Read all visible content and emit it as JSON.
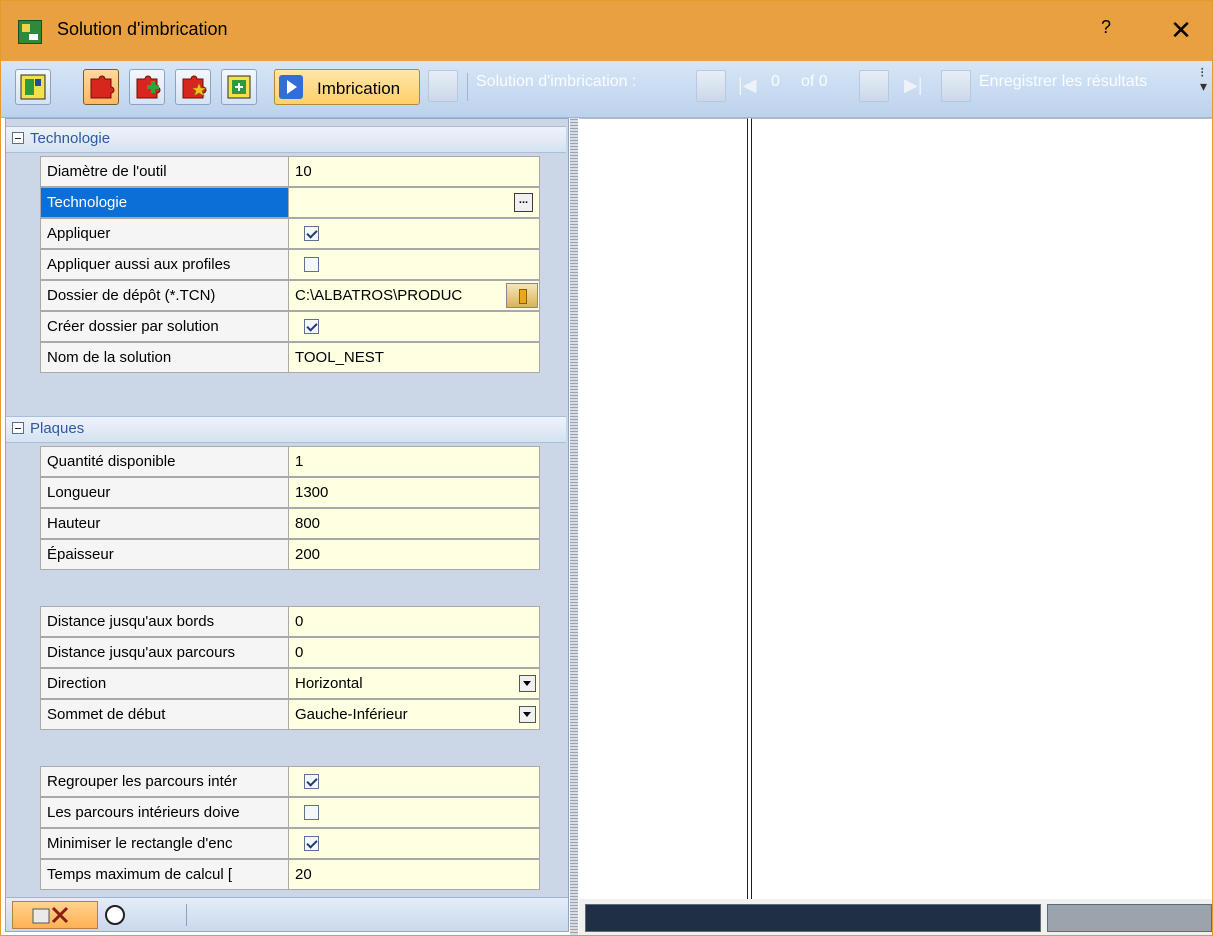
{
  "window": {
    "title": "Solution d'imbrication",
    "help": "?",
    "close": "✕"
  },
  "toolbar": {
    "imbrication_label": "Imbrication",
    "solution_label": "Solution d'imbrication :",
    "index": "0",
    "of_label": "of 0",
    "save_label": "Enregistrer les résultats"
  },
  "technologie": {
    "header": "Technologie",
    "rows": [
      {
        "label": "Diamètre de l'outil",
        "value": "10"
      },
      {
        "label": "Technologie",
        "value": ""
      },
      {
        "label": "Appliquer",
        "checked": true
      },
      {
        "label": "Appliquer aussi aux profiles",
        "checked": false
      },
      {
        "label": "Dossier de dépôt (*.TCN)",
        "value": "C:\\ALBATROS\\PRODUC"
      },
      {
        "label": "Créer dossier par solution",
        "checked": true
      },
      {
        "label": "Nom de la solution",
        "value": "TOOL_NEST"
      }
    ]
  },
  "plaques": {
    "header": "Plaques",
    "rows": [
      {
        "label": "Quantité disponible",
        "value": "1"
      },
      {
        "label": "Longueur",
        "value": "1300"
      },
      {
        "label": "Hauteur",
        "value": "800"
      },
      {
        "label": "Épaisseur",
        "value": "200"
      }
    ]
  },
  "placement": {
    "rows": [
      {
        "label": "Distance jusqu'aux bords",
        "value": "0"
      },
      {
        "label": "Distance jusqu'aux parcours",
        "value": "0"
      },
      {
        "label": "Direction",
        "value": "Horizontal"
      },
      {
        "label": "Sommet de début",
        "value": "Gauche-Inférieur"
      }
    ]
  },
  "options": {
    "rows": [
      {
        "label": "Regrouper les parcours intér",
        "checked": true
      },
      {
        "label": "Les parcours intérieurs doive",
        "checked": false
      },
      {
        "label": "Minimiser le rectangle d'enc",
        "checked": true
      },
      {
        "label": "Temps maximum de calcul [",
        "value": "20"
      }
    ]
  },
  "icons": {
    "app": "nesting-app-icon",
    "toolbar": [
      "layout-icon",
      "puzzle-red-icon",
      "puzzle-add-icon",
      "puzzle-star-icon",
      "import-icon",
      "play-icon"
    ],
    "bottom_tabs": [
      "tools-icon",
      "circle-icon"
    ]
  }
}
